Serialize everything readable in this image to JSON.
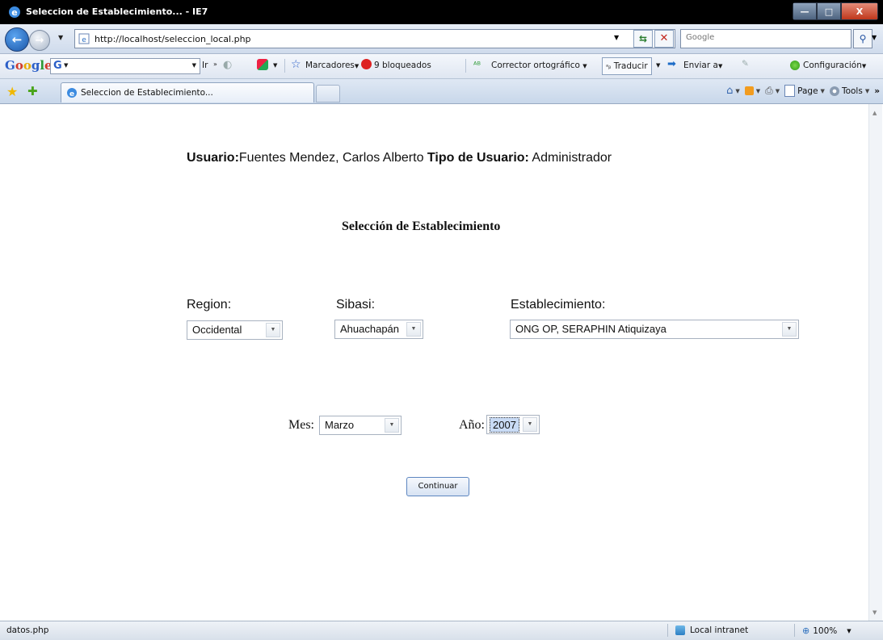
{
  "window": {
    "title": "Seleccion de Establecimiento... - IE7",
    "controls": {
      "minimize": "—",
      "maximize": "□",
      "close": "X"
    }
  },
  "address_bar": {
    "url": "http://localhost/seleccion_local.php",
    "search_placeholder": "Google"
  },
  "google_toolbar": {
    "search_button": "Ir",
    "bookmarks": "Marcadores",
    "blocked": "9 bloqueados",
    "spellcheck": "Corrector ortográfico",
    "translate": "Traducir",
    "send": "Enviar a",
    "settings": "Configuración"
  },
  "tabs": [
    {
      "label": "Seleccion de Establecimiento..."
    }
  ],
  "command_bar": {
    "page": "Page",
    "tools": "Tools"
  },
  "page": {
    "user_label": "Usuario:",
    "user_name": "Fuentes Mendez, Carlos Alberto",
    "user_type_label": "Tipo de Usuario:",
    "user_type": "Administrador",
    "heading": "Selección de Establecimiento",
    "region_label": "Region:",
    "region_value": "Occidental",
    "sibasi_label": "Sibasi:",
    "sibasi_value": "Ahuachapán",
    "establecimiento_label": "Establecimiento:",
    "establecimiento_value": "ONG OP, SERAPHIN Atiquizaya",
    "mes_label": "Mes:",
    "mes_value": "Marzo",
    "anio_label": "Año:",
    "anio_value": "2007",
    "continue_button": "Continuar"
  },
  "status_bar": {
    "text": "datos.php",
    "zone": "Local intranet",
    "zoom": "100%"
  },
  "colors": {
    "title_bar": "#000000",
    "chrome_light": "#e8eef7",
    "chrome_dark": "#cfdbec",
    "selection": "#c9dbf5"
  }
}
